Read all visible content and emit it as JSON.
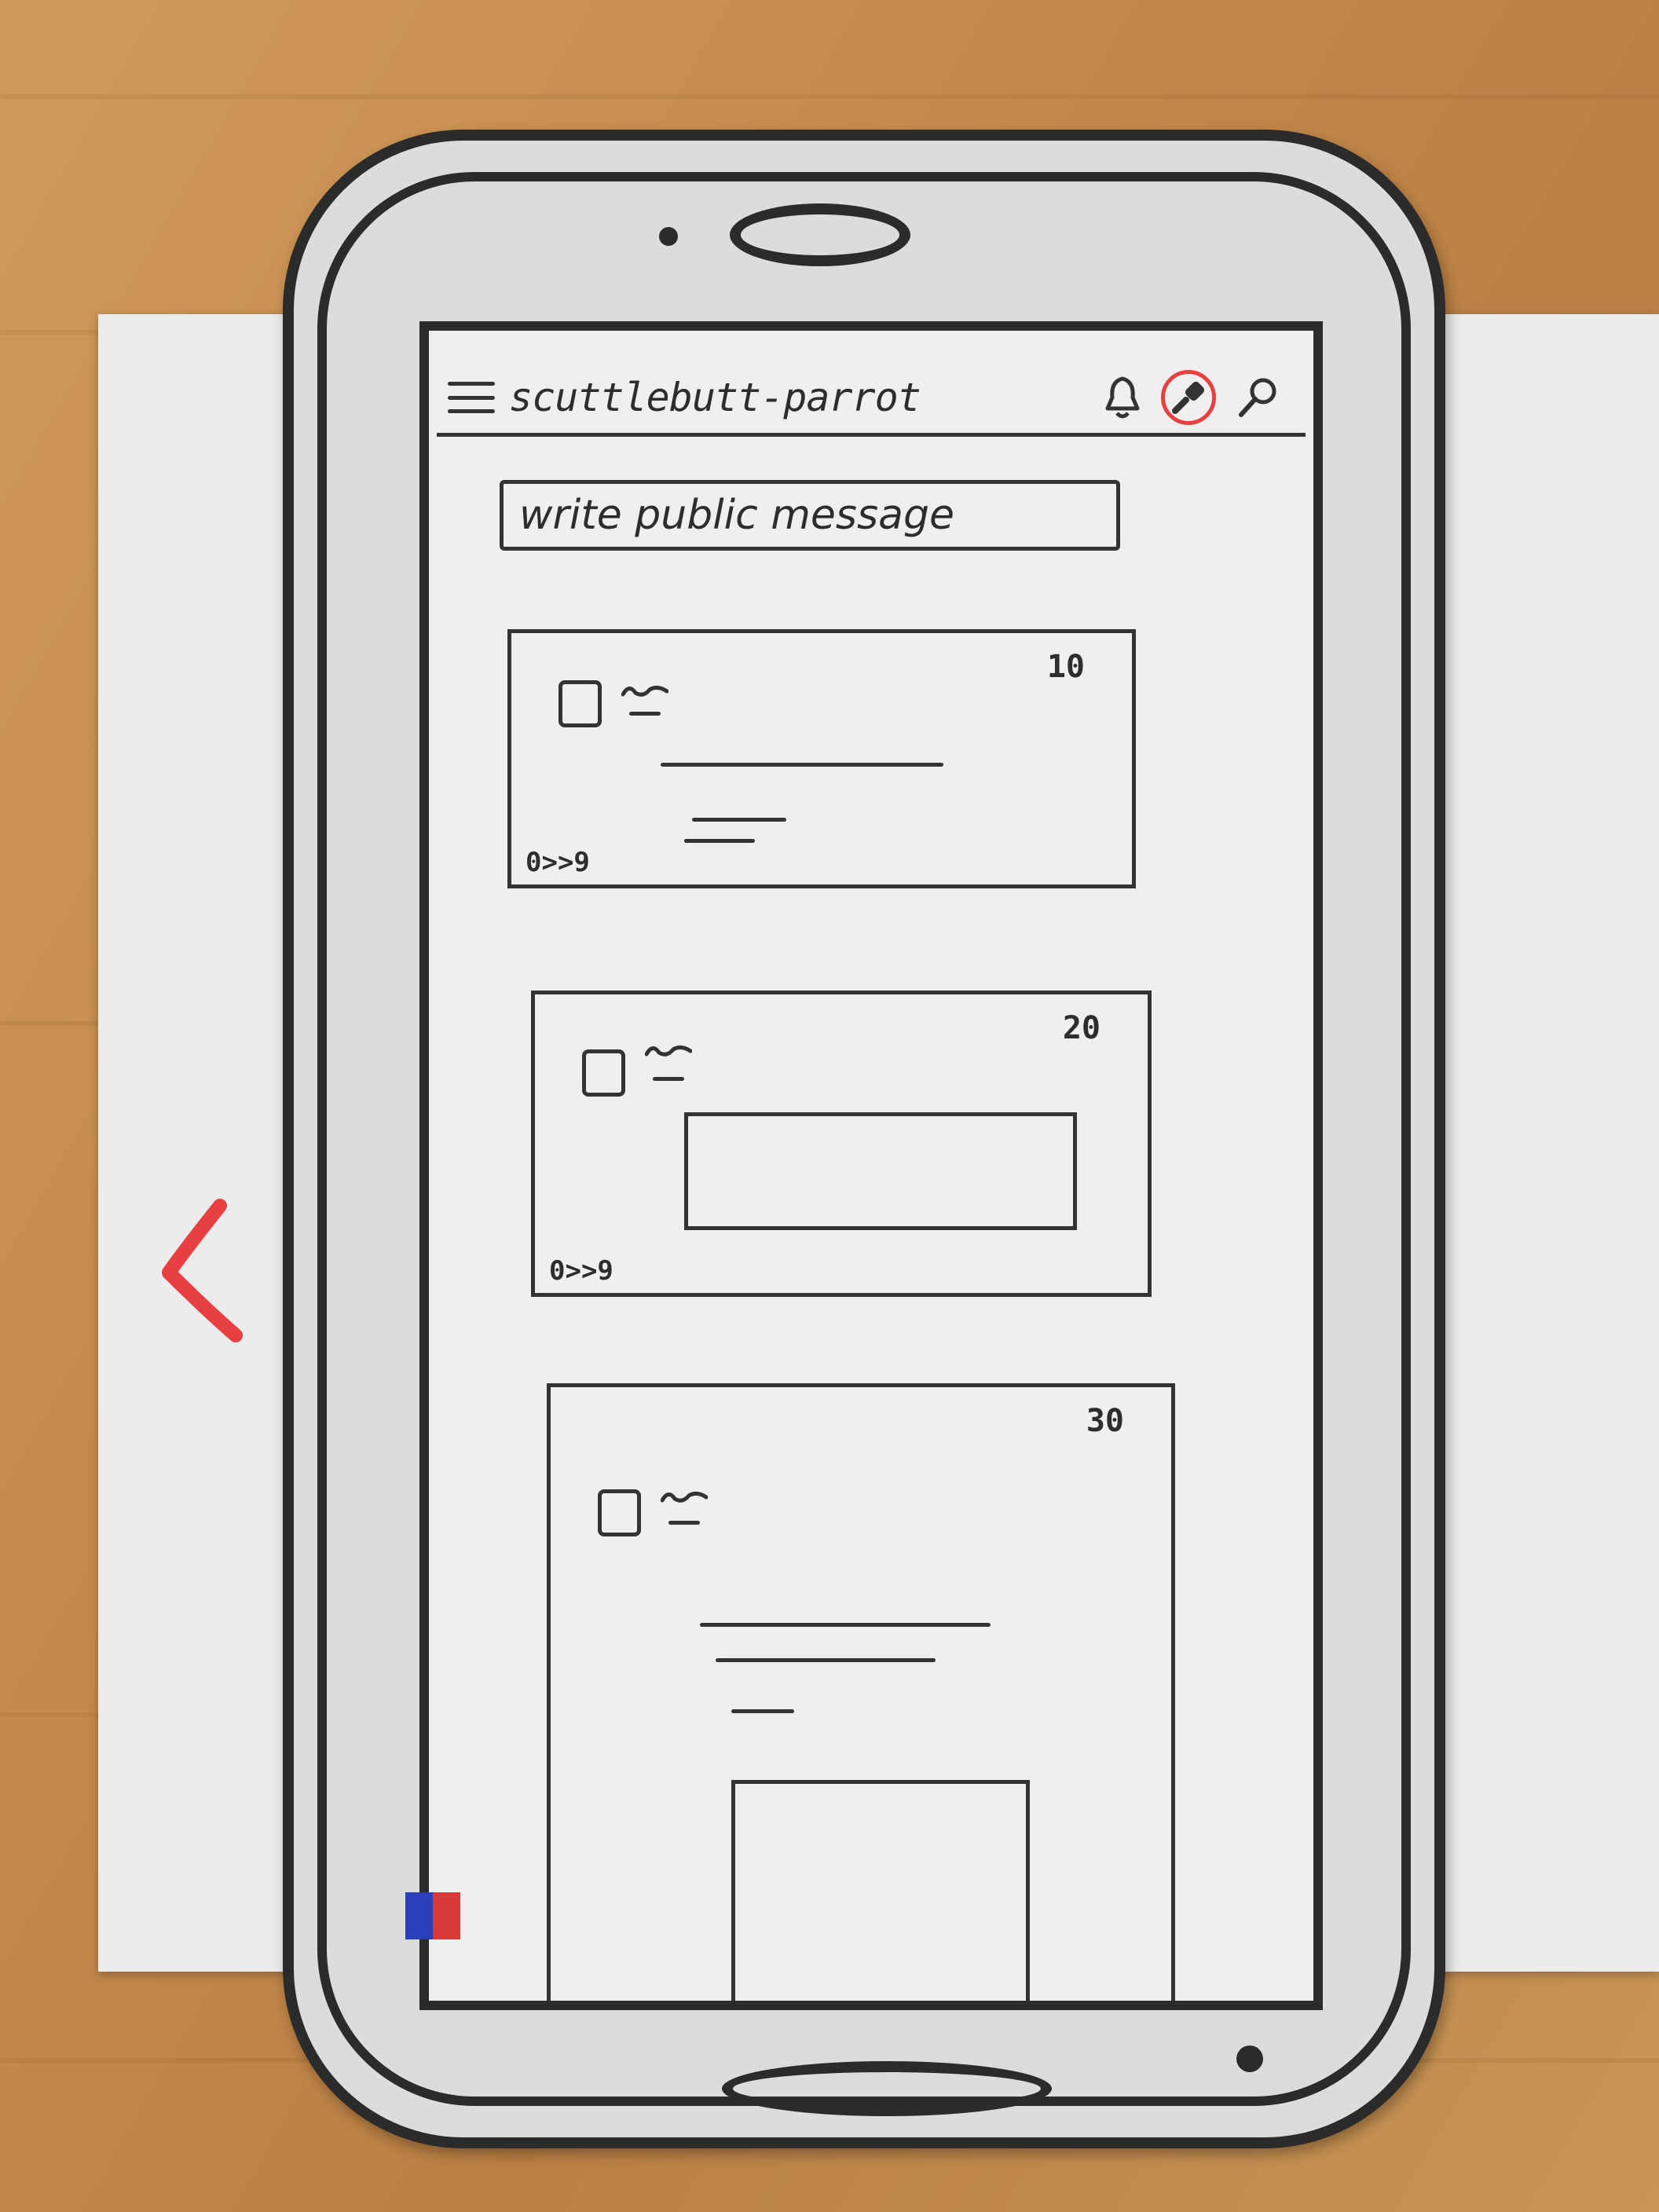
{
  "colors": {
    "ink": "#2b2b2b",
    "accent_red": "#e84040",
    "paper": "#efefef",
    "table_wood": "#c48a4c"
  },
  "topbar": {
    "menu_icon": "hamburger-icon",
    "title": "scuttlebutt-parrot",
    "icons": [
      "bell-icon",
      "paint-brush-icon",
      "search-icon"
    ]
  },
  "compose": {
    "placeholder": "write public message"
  },
  "feed": [
    {
      "count": "10",
      "footer": "0>>9"
    },
    {
      "count": "20",
      "footer": "0>>9"
    },
    {
      "count": "30"
    }
  ],
  "navigation": {
    "back_icon": "chevron-left-icon"
  }
}
